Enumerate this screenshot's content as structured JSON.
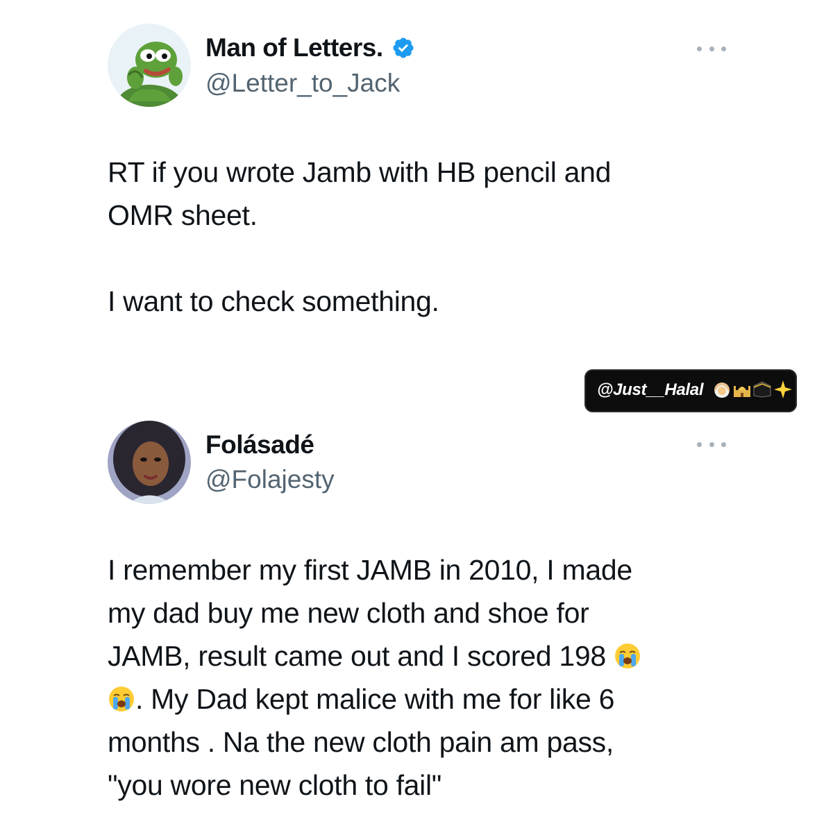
{
  "tweets": [
    {
      "display_name": "Man of Letters.",
      "verified": true,
      "handle": "@Letter_to_Jack",
      "avatar_icon": "pepe-frog-avatar",
      "more_icon": "more-options-icon",
      "text": "RT if you wrote Jamb with HB pencil and\nOMR sheet.\n\nI want to check something."
    },
    {
      "display_name": "Folásadé",
      "verified": false,
      "handle": "@Folajesty",
      "avatar_icon": "profile-photo-avatar",
      "more_icon": "more-options-icon",
      "text_parts": [
        "I remember my first JAMB in 2010, I made\nmy dad buy me new cloth and shoe for\nJAMB, result came out and I scored 198 ",
        "\n",
        ". My Dad kept malice with me for like 6\nmonths . Na the new cloth pain am pass,\n\"you wore new cloth to fail\""
      ],
      "emoji": "loudly-crying-face-icon"
    }
  ],
  "watermark": {
    "text": "@Just__Halal",
    "icons": [
      "person-with-headscarf-icon",
      "mosque-icon",
      "kaaba-icon",
      "sparkle-icon"
    ]
  },
  "colors": {
    "verified_badge": "#1d9bf0",
    "handle": "#536471",
    "text": "#0f1419"
  }
}
